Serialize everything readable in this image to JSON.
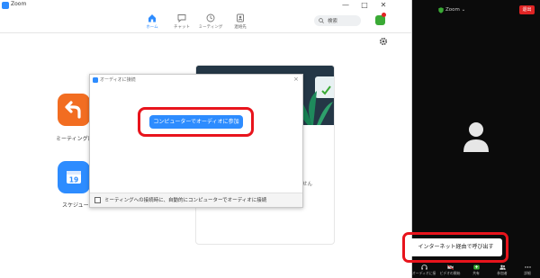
{
  "app": {
    "title": "Zoom"
  },
  "window_controls": {
    "minimize": "—",
    "maximize": "□",
    "close": "✕"
  },
  "nav": {
    "tabs": [
      {
        "label": "ホーム",
        "icon": "home-icon",
        "active": true
      },
      {
        "label": "チャット",
        "icon": "chat-icon",
        "active": false
      },
      {
        "label": "ミーティング",
        "icon": "clock-icon",
        "active": false
      },
      {
        "label": "連絡先",
        "icon": "contacts-icon",
        "active": false
      }
    ]
  },
  "search": {
    "placeholder": "検索"
  },
  "home": {
    "new_meeting_label": "ミーティングに戻",
    "schedule_label": "スケジュール",
    "calendar_day": "19",
    "card_text": "せん"
  },
  "dialog": {
    "title": "オーディオに接続",
    "close": "×",
    "join_button": "コンピューターでオーディオに参加",
    "auto_join_label": "ミーティングへの接続時に、自動的にコンピューターでオーディオに接続"
  },
  "meeting": {
    "zoom_label": "Zoom ⌄",
    "leave_button": "退出",
    "controls": [
      {
        "label": "オーディオに接",
        "icon": "headphone-icon"
      },
      {
        "label": "ビデオの開始",
        "icon": "video-off-icon"
      },
      {
        "label": "共有",
        "icon": "share-screen-icon"
      },
      {
        "label": "参加者",
        "icon": "participants-icon"
      },
      {
        "label": "詳細",
        "icon": "more-icon"
      }
    ],
    "tooltip": "インターネット経由で呼び出す"
  },
  "colors": {
    "accent": "#2d8cff",
    "highlight": "#e8141c",
    "orange_button": "#f26d21",
    "leave": "#e02424",
    "meeting_bg": "#0b0b0b"
  }
}
